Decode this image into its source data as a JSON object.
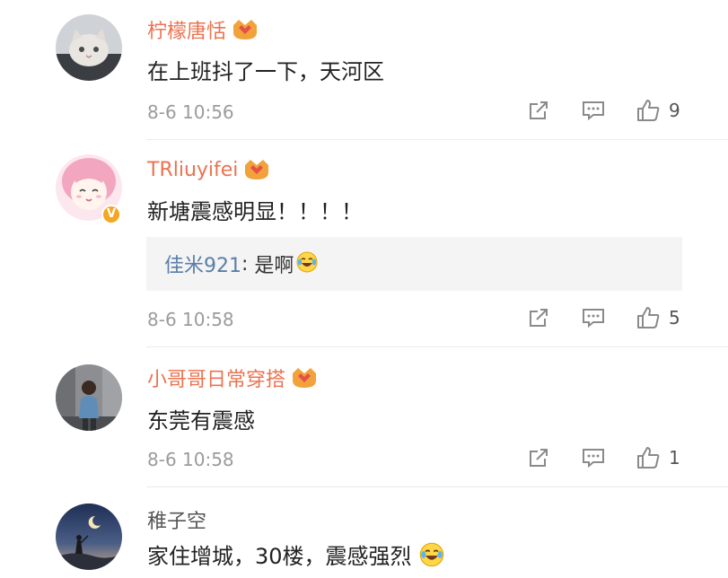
{
  "comments": [
    {
      "username": "柠檬唐恬",
      "has_fan_badge": true,
      "text": "在上班抖了一下，天河区",
      "time": "8-6 10:56",
      "likes": "9"
    },
    {
      "username": "TRliuyifei",
      "has_fan_badge": true,
      "verified": true,
      "text": "新塘震感明显！！！！",
      "reply": {
        "user": "佳米921",
        "separator": ": ",
        "text": "是啊"
      },
      "time": "8-6 10:58",
      "likes": "5"
    },
    {
      "username": "小哥哥日常穿搭",
      "has_fan_badge": true,
      "text": "东莞有震感",
      "time": "8-6 10:58",
      "likes": "1"
    },
    {
      "username": "稚子空",
      "has_fan_badge": false,
      "text": "家住增城，30楼，震感强烈"
    }
  ],
  "icons": {
    "share": "share-icon",
    "comment": "comment-icon",
    "like": "thumbs-up-icon",
    "emoji": "laugh-cry-emoji-icon",
    "fan_badge": "fan-badge-icon",
    "verified": "verified-badge-icon"
  },
  "colors": {
    "username": "#eb7350",
    "reply_user": "#5b7ea8",
    "meta": "#9b9b9b",
    "reply_bg": "#f4f4f4",
    "verified": "#f5a623"
  }
}
